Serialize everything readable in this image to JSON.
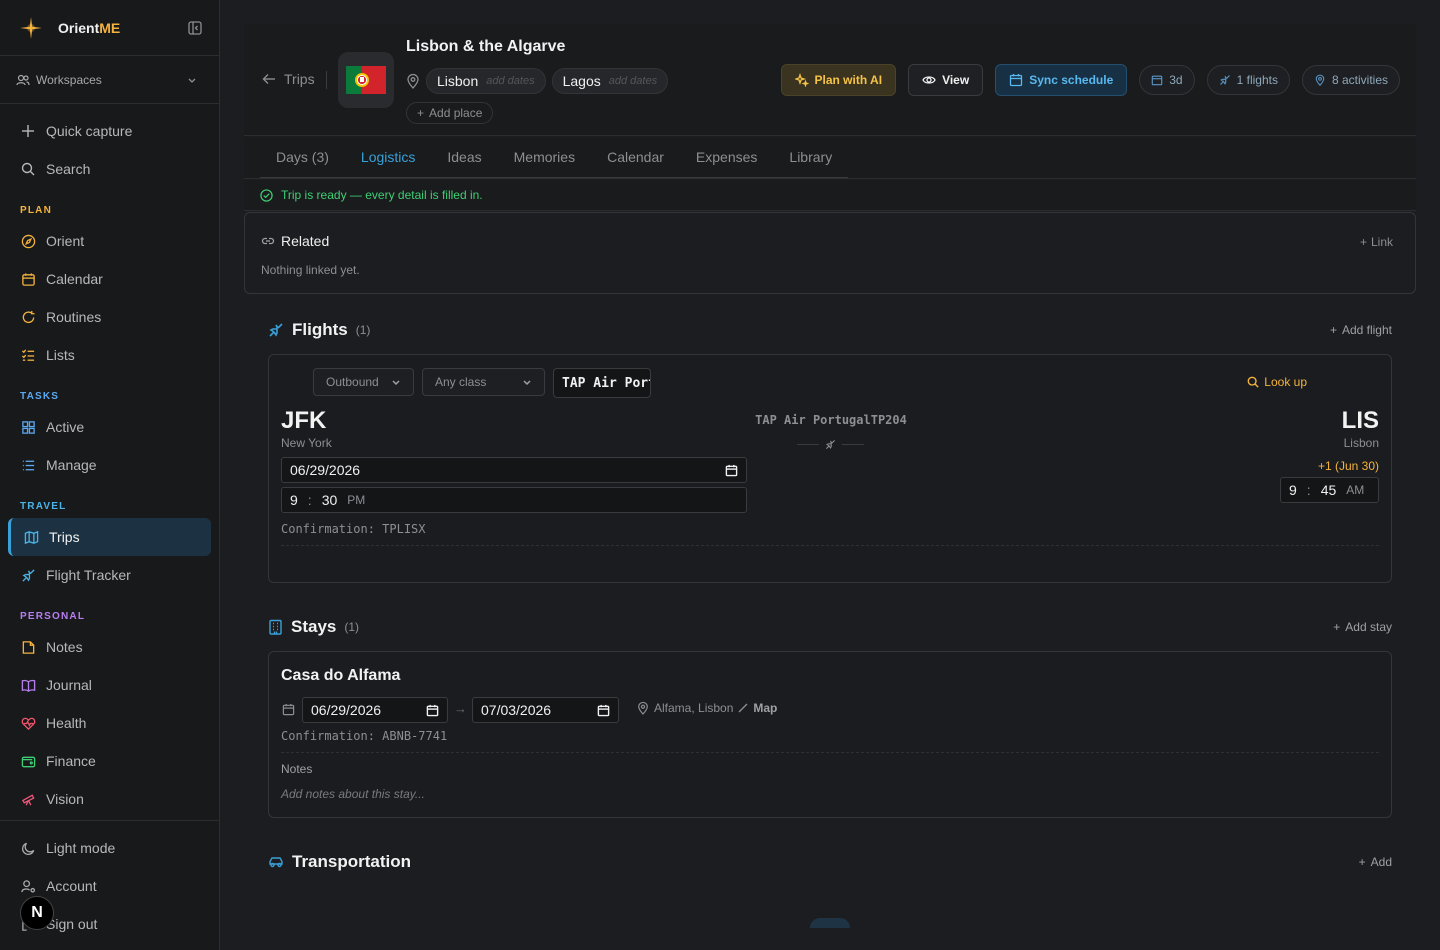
{
  "brand": {
    "name_main": "Orient",
    "name_accent": "ME"
  },
  "workspace": {
    "label": "Workspaces"
  },
  "nav": {
    "quick_capture": "Quick capture",
    "search": "Search",
    "sections": {
      "plan": {
        "label": "PLAN",
        "color": "#f5b33d",
        "items": [
          {
            "label": "Orient",
            "icon": "compass-icon"
          },
          {
            "label": "Calendar",
            "icon": "calendar-icon"
          },
          {
            "label": "Routines",
            "icon": "refresh-icon"
          },
          {
            "label": "Lists",
            "icon": "list-check-icon"
          }
        ]
      },
      "tasks": {
        "label": "TASKS",
        "color": "#5aa8f0",
        "items": [
          {
            "label": "Active",
            "icon": "grid-icon"
          },
          {
            "label": "Manage",
            "icon": "list-icon"
          }
        ]
      },
      "travel": {
        "label": "TRAVEL",
        "color": "#4ab4e8",
        "items": [
          {
            "label": "Trips",
            "icon": "map-icon"
          },
          {
            "label": "Flight Tracker",
            "icon": "plane-icon"
          }
        ]
      },
      "personal": {
        "label": "PERSONAL",
        "color": "#b77ef0",
        "items": [
          {
            "label": "Notes",
            "icon": "note-icon"
          },
          {
            "label": "Journal",
            "icon": "book-icon"
          },
          {
            "label": "Health",
            "icon": "heart-icon"
          },
          {
            "label": "Finance",
            "icon": "wallet-icon"
          },
          {
            "label": "Vision",
            "icon": "telescope-icon"
          }
        ]
      }
    },
    "footer": {
      "light_mode": "Light mode",
      "account": "Account",
      "sign_out": "Sign out",
      "avatar_letter": "N"
    }
  },
  "trip": {
    "back_label": "Trips",
    "flag": "🇵🇹",
    "title": "Lisbon & the Algarve",
    "places": [
      {
        "name": "Lisbon",
        "hint": "add dates"
      },
      {
        "name": "Lagos",
        "hint": "add dates"
      }
    ],
    "add_place": "Add place",
    "actions": {
      "plan_ai": "Plan with AI",
      "view": "View",
      "sync": "Sync schedule"
    },
    "pills": {
      "days": "3d",
      "flights": "1 flights",
      "activities": "8 activities"
    }
  },
  "tabs": [
    "Days (3)",
    "Logistics",
    "Ideas",
    "Memories",
    "Calendar",
    "Expenses",
    "Library"
  ],
  "active_tab": "Logistics",
  "status": {
    "ready": "Trip is ready — every detail is filled in."
  },
  "related": {
    "title": "Related",
    "empty": "Nothing linked yet.",
    "link": "Link"
  },
  "flights": {
    "title": "Flights",
    "count": "(1)",
    "add": "Add flight",
    "item": {
      "direction": "Outbound",
      "class": "Any class",
      "airline_input": "TAP Air Portugal",
      "lookup": "Look up",
      "from_code": "JFK",
      "from_city": "New York",
      "to_code": "LIS",
      "to_city": "Lisbon",
      "flight_label": "TAP Air PortugalTP204",
      "depart_date": "06/29/2026",
      "depart_time": {
        "h": "9",
        "m": "30",
        "ampm": "PM"
      },
      "arrive_offset": "+1 (Jun 30)",
      "arrive_time": {
        "h": "9",
        "m": "45",
        "ampm": "AM"
      },
      "confirmation": "Confirmation: TPLISX"
    }
  },
  "stays": {
    "title": "Stays",
    "count": "(1)",
    "add": "Add stay",
    "item": {
      "name": "Casa do Alfama",
      "check_in": "06/29/2026",
      "check_out": "07/03/2026",
      "location": "Alfama, Lisbon",
      "map": "Map",
      "confirmation": "Confirmation: ABNB-7741",
      "notes_label": "Notes",
      "notes_placeholder": "Add notes about this stay..."
    }
  },
  "transportation": {
    "title": "Transportation",
    "add": "Add"
  }
}
